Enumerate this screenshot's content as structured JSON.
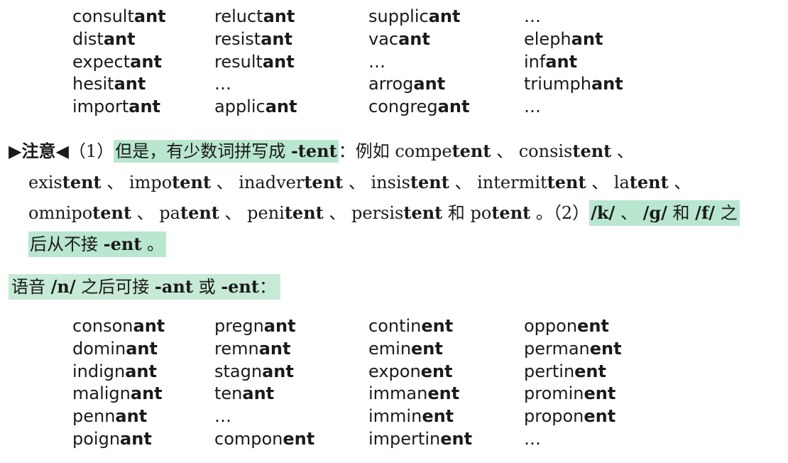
{
  "grid1": [
    [
      "consult",
      "ant"
    ],
    [
      "reluct",
      "ant"
    ],
    [
      "supplic",
      "ant"
    ],
    [
      "…",
      ""
    ],
    [
      "dist",
      "ant"
    ],
    [
      "resist",
      "ant"
    ],
    [
      "vac",
      "ant"
    ],
    [
      "eleph",
      "ant"
    ],
    [
      "expect",
      "ant"
    ],
    [
      "result",
      "ant"
    ],
    [
      "…",
      ""
    ],
    [
      "inf",
      "ant"
    ],
    [
      "hesit",
      "ant"
    ],
    [
      "…",
      ""
    ],
    [
      "arrog",
      "ant"
    ],
    [
      "triumph",
      "ant"
    ],
    [
      "import",
      "ant"
    ],
    [
      "applic",
      "ant"
    ],
    [
      "congreg",
      "ant"
    ],
    [
      "…",
      ""
    ]
  ],
  "note": {
    "marker": "▶注意◀",
    "p1": "（1）",
    "hl1": "但是，有少数词拼写成 ",
    "hl1_bold": "-tent",
    "colon1": "：例如 ",
    "sep": " 、 ",
    "words": [
      [
        "compe",
        "tent"
      ],
      [
        "consis",
        "tent"
      ],
      [
        "exis",
        "tent"
      ],
      [
        "impo",
        "tent"
      ],
      [
        "inadver",
        "tent"
      ],
      [
        "insis",
        "tent"
      ],
      [
        "intermit",
        "tent"
      ],
      [
        "la",
        "tent"
      ],
      [
        "omnipo",
        "tent"
      ],
      [
        "pa",
        "tent"
      ],
      [
        "peni",
        "tent"
      ],
      [
        "persis",
        "tent"
      ],
      [
        "po",
        "tent"
      ]
    ],
    "and": "和",
    "period": " 。",
    "p2": "（2）",
    "hl2_k": "/k/",
    "hl2_g": "/g/",
    "hl2_and": " 和 ",
    "hl2_f": "/f/",
    "hl2_after": " 之",
    "hl2_line2": "后从不接 ",
    "hl2_ent": "-ent",
    "hl2_end": " 。"
  },
  "rule": {
    "pre": "语音 ",
    "n": "/n/",
    "mid": " 之后可接 ",
    "ant": "-ant",
    "or": " 或 ",
    "ent": "-ent",
    "colon": "："
  },
  "grid2": [
    [
      "conson",
      "ant"
    ],
    [
      "pregn",
      "ant"
    ],
    [
      "contin",
      "ent"
    ],
    [
      "oppon",
      "ent"
    ],
    [
      "domin",
      "ant"
    ],
    [
      "remn",
      "ant"
    ],
    [
      "emin",
      "ent"
    ],
    [
      "perman",
      "ent"
    ],
    [
      "indign",
      "ant"
    ],
    [
      "stagn",
      "ant"
    ],
    [
      "expon",
      "ent"
    ],
    [
      "pertin",
      "ent"
    ],
    [
      "malign",
      "ant"
    ],
    [
      "ten",
      "ant"
    ],
    [
      "imman",
      "ent"
    ],
    [
      "promin",
      "ent"
    ],
    [
      "penn",
      "ant"
    ],
    [
      "…",
      ""
    ],
    [
      "immin",
      "ent"
    ],
    [
      "propon",
      "ent"
    ],
    [
      "poign",
      "ant"
    ],
    [
      "compon",
      "ent"
    ],
    [
      "impertin",
      "ent"
    ],
    [
      "…",
      ""
    ]
  ],
  "colors": {
    "highlight": "#b9e6cf",
    "text": "#1a1a1a"
  }
}
